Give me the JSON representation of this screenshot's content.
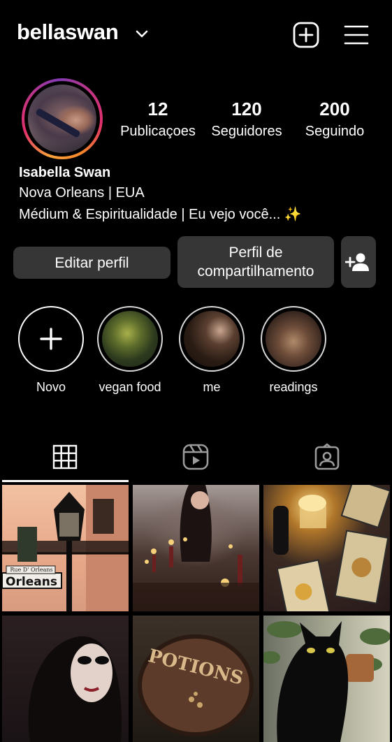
{
  "header": {
    "username": "bellaswan",
    "icons": [
      "chevron-down-icon",
      "plus-square-icon",
      "menu-icon"
    ]
  },
  "stats": {
    "posts": {
      "value": "12",
      "label": "Publicaçoes"
    },
    "followers": {
      "value": "120",
      "label": "Seguidores"
    },
    "following": {
      "value": "200",
      "label": "Seguindo"
    }
  },
  "bio": {
    "name": "Isabella Swan",
    "line1": "Nova Orleans | EUA",
    "line2": "Médium & Espiritualidade | Eu vejo você... ✨"
  },
  "buttons": {
    "edit": "Editar perfil",
    "share": "Perfil de compartilhamento",
    "add_person_icon": "add-person-icon"
  },
  "highlights": [
    {
      "label": "Novo"
    },
    {
      "label": "vegan food"
    },
    {
      "label": "me"
    },
    {
      "label": "readings"
    }
  ],
  "tabs": [
    "grid-icon",
    "reels-icon",
    "tagged-icon"
  ],
  "grid": {
    "c1_sign": "Orleans",
    "c1_small_sign": "Rue D' Orleans",
    "c5_sign": "POTIONS"
  },
  "colors": {
    "background": "#000000",
    "button": "#363636",
    "ring_start": "#f9a23b",
    "ring_end": "#c13584"
  }
}
